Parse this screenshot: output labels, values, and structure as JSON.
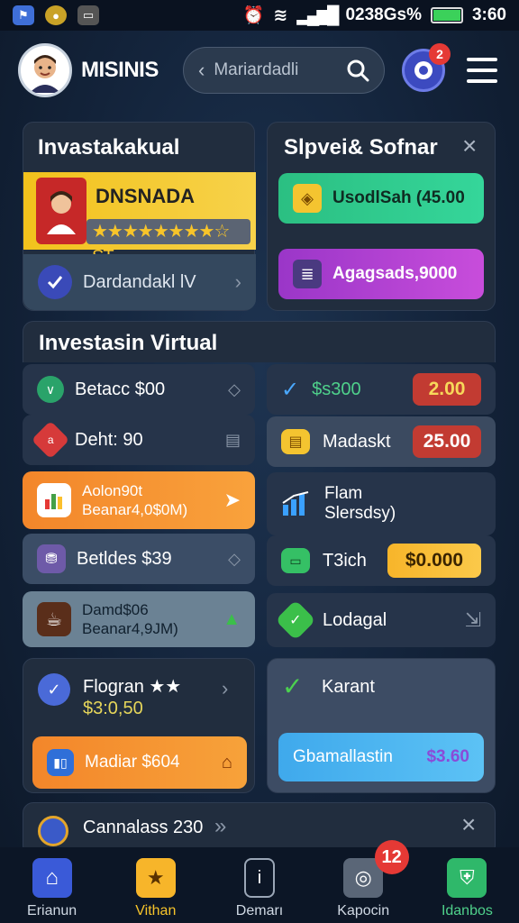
{
  "status_bar": {
    "right_text": "0238Gs%",
    "time": "3:60"
  },
  "header": {
    "app_title": "MISINIS",
    "search_placeholder": "Mariardadli",
    "notification_count": "2"
  },
  "card_top_left": {
    "title": "Invastakakual",
    "banner_name": "DNSNADA",
    "stars_text": "★★★★★★★★☆ ST",
    "row_label": "Dardandakl lV"
  },
  "card_top_right": {
    "title": "Slpvei& Sofnar",
    "button1": "UsodlSah  (45.00",
    "button2": "Agagsads,9000"
  },
  "section": {
    "title": "Investasin Virtual",
    "left_rows": [
      {
        "label": "Betacc $00"
      },
      {
        "label": "Deht: 90"
      },
      {
        "line1": "Aolon90t",
        "line2": "Beanar4,0$0M)"
      },
      {
        "label": "Betldes $39"
      },
      {
        "line1": "Damd$06",
        "line2": "Beanar4,9JM)"
      }
    ],
    "right_rows": [
      {
        "label": "$s300",
        "value": "2.00"
      },
      {
        "label": "Madaskt",
        "value": "25.00"
      },
      {
        "line1": "Flam",
        "line2": "Slersdsy)"
      },
      {
        "label": "T3ich",
        "value": "$0.000"
      },
      {
        "label": "Lodagal"
      }
    ]
  },
  "card_bottom_left": {
    "title": "Flogran ★★",
    "amount": "$3:0,50",
    "button": "Madiar $604"
  },
  "card_bottom_right": {
    "title": "Karant",
    "button_label": "Gbamallastin",
    "button_value": "$3.60"
  },
  "card_partial": {
    "label": "Cannalass 230"
  },
  "bottom_nav": {
    "items": [
      {
        "label": "Erianun"
      },
      {
        "label": "Vithan"
      },
      {
        "label": "Demarı"
      },
      {
        "label": "Kapocin"
      },
      {
        "label": "Idanbos"
      }
    ],
    "badge": "12"
  },
  "colors": {
    "accent_green": "#2fc08a",
    "accent_purple": "#b43fd0",
    "accent_orange": "#f7892c",
    "accent_blue": "#45b3ee",
    "value_red": "#c23b32",
    "value_gold": "#f7b52a"
  }
}
